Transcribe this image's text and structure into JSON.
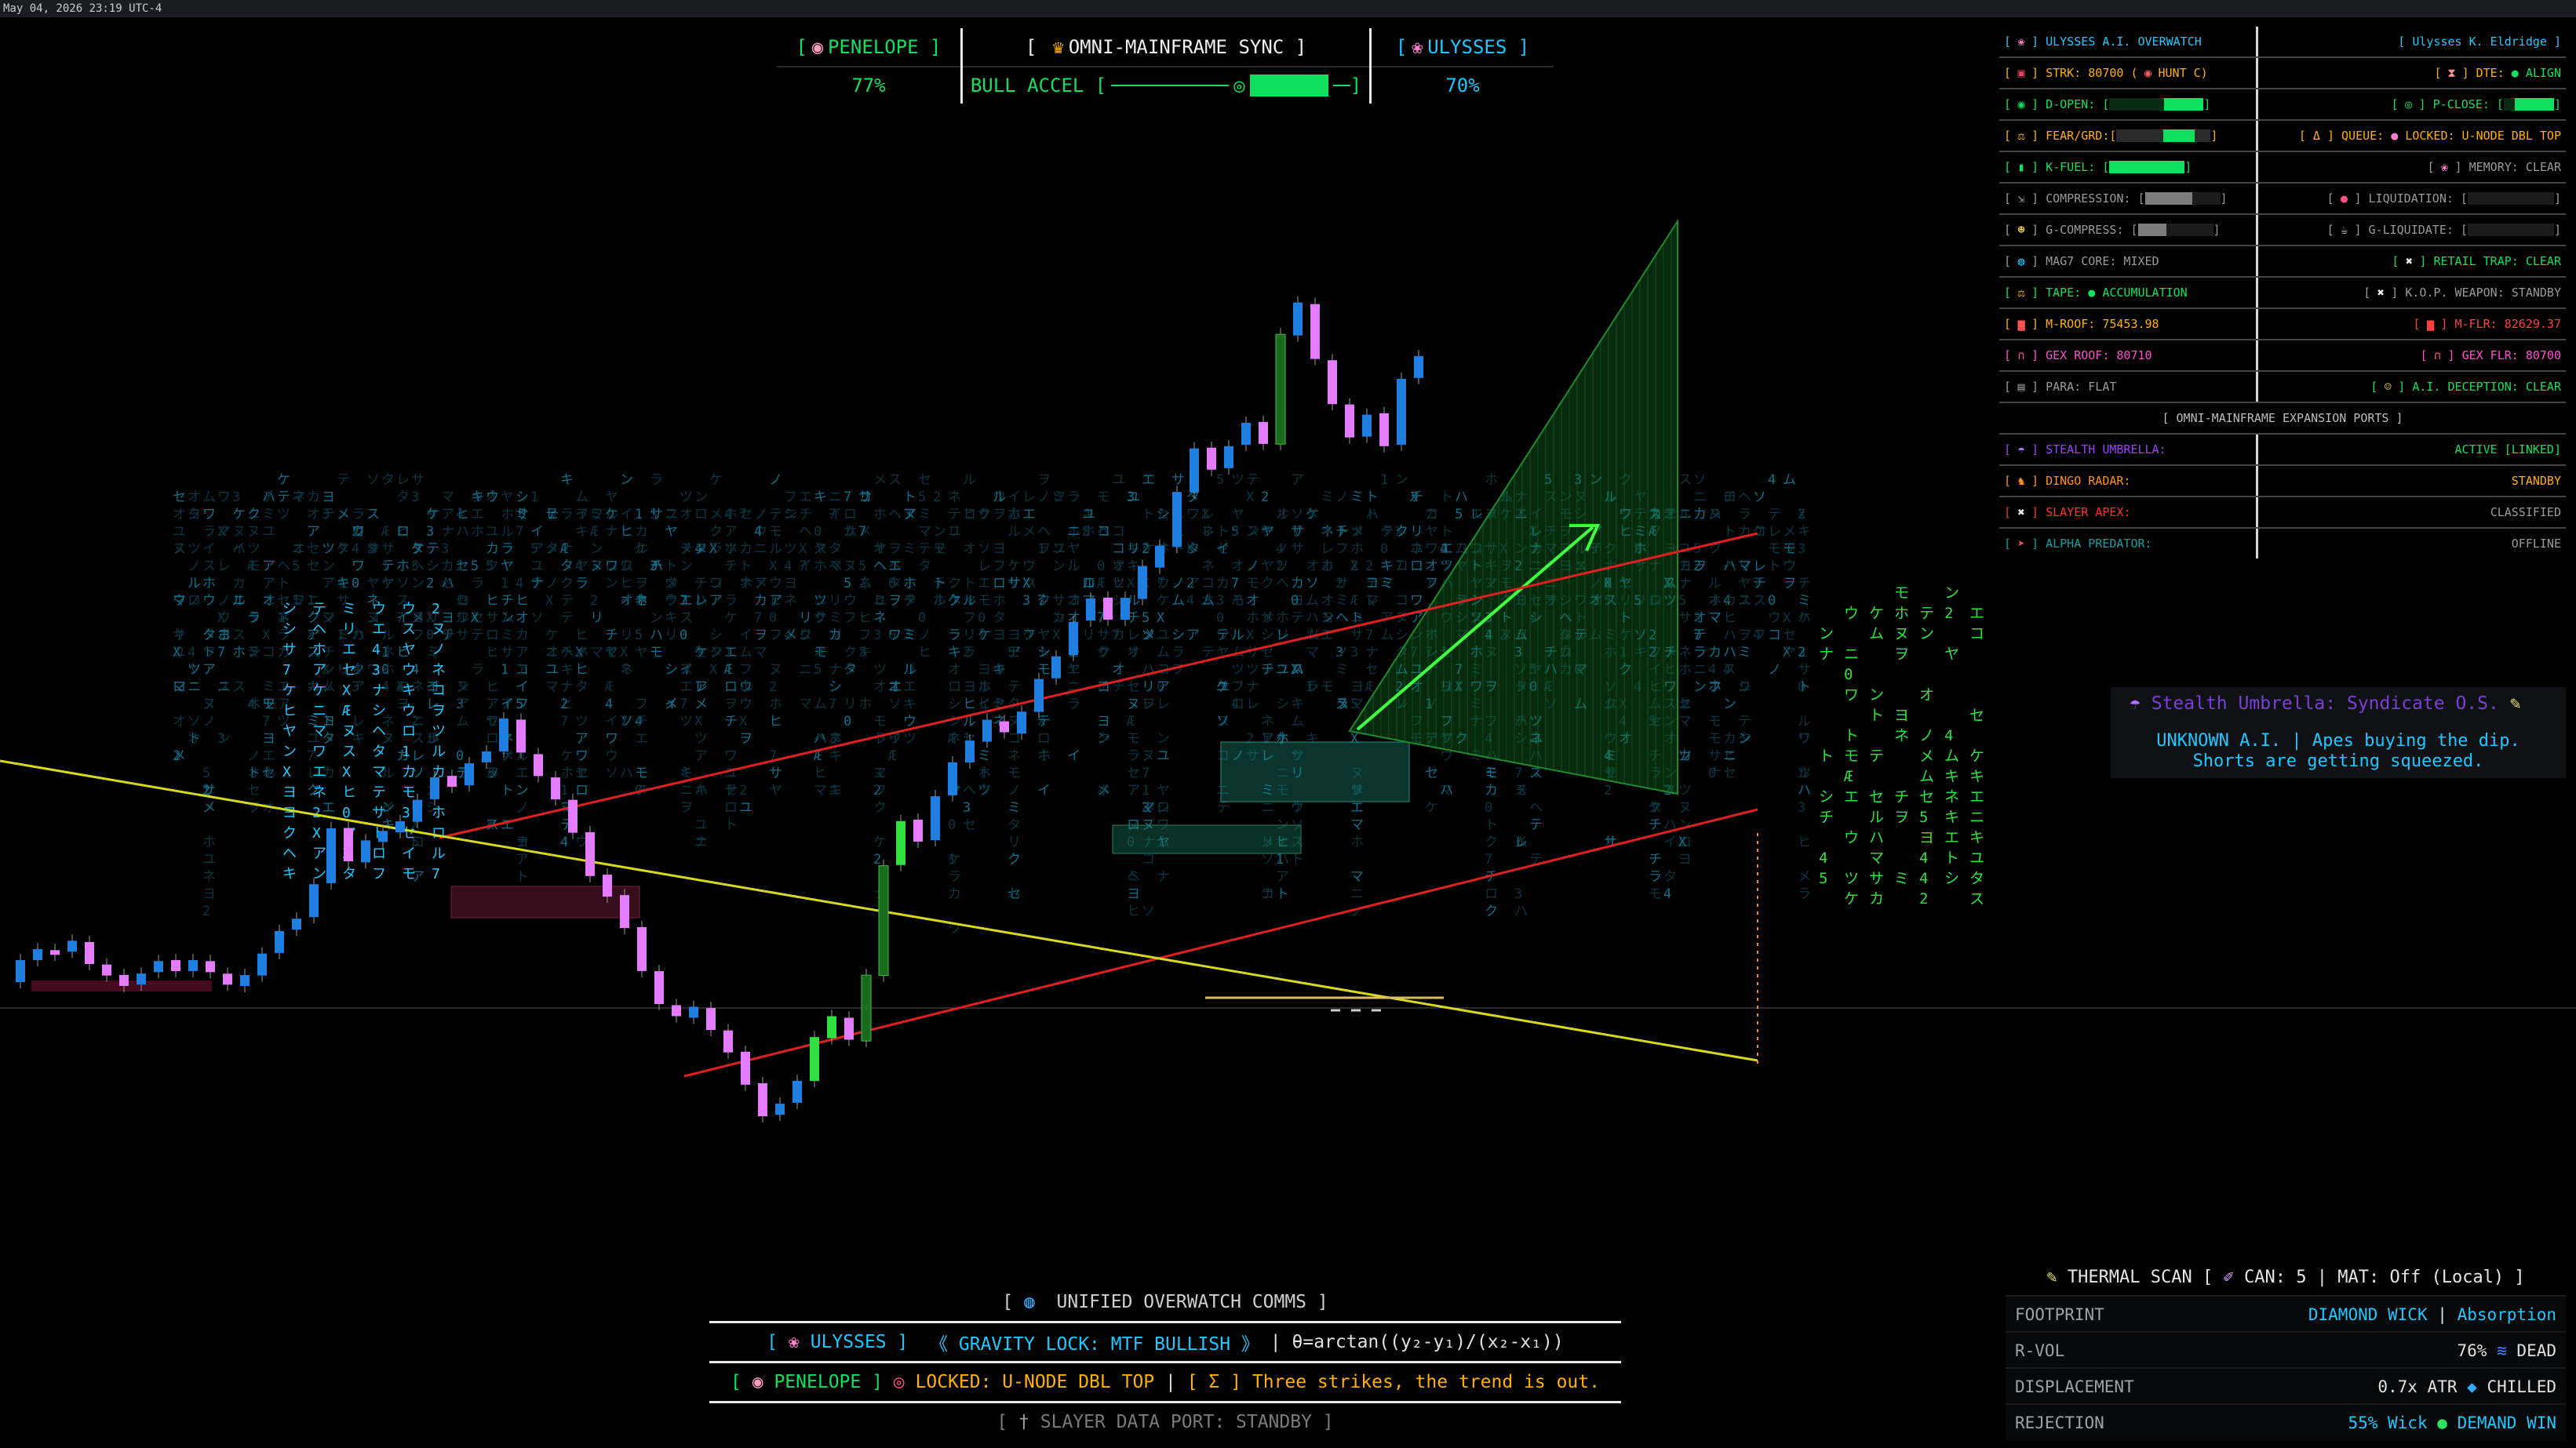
{
  "topbar": {
    "datetime": "May 04, 2026 23:19 UTC-4"
  },
  "sync_panel": {
    "left_name": "PENELOPE",
    "left_value": "77%",
    "center_title": "OMNI-MAINFRAME SYNC",
    "center_label": "BULL ACCEL",
    "right_name": "ULYSSES",
    "right_value": "70%"
  },
  "overwatch": {
    "header_left": "ULYSSES A.I. OVERWATCH",
    "header_right": "Ulysses K. Eldridge",
    "rows": [
      {
        "l": "STRK: 80700 (",
        "l2": "HUNT C)",
        "r": "DTE:",
        "r2": "ALIGN"
      },
      {
        "l": "D-OPEN:",
        "r": "P-CLOSE:"
      },
      {
        "l": "FEAR/GRD:",
        "r": "QUEUE:",
        "r2": "LOCKED: U-NODE DBL TOP"
      },
      {
        "l": "K-FUEL:",
        "r": "MEMORY: CLEAR"
      },
      {
        "l": "COMPRESSION:",
        "r": "LIQUIDATION:"
      },
      {
        "l": "G-COMPRESS:",
        "r": "G-LIQUIDATE:"
      },
      {
        "l": "MAG7 CORE: MIXED",
        "r": "RETAIL TRAP: CLEAR"
      },
      {
        "l": "TAPE:",
        "l2": "ACCUMULATION",
        "r": "K.O.P. WEAPON: STANDBY"
      },
      {
        "l": "M-ROOF: 75453.98",
        "r": "M-FLR: 82629.37"
      },
      {
        "l": "GEX ROOF: 80710",
        "r": "GEX FLR: 80700"
      },
      {
        "l": "PARA: FLAT",
        "r": "A.I. DECEPTION: CLEAR"
      }
    ],
    "ports_title": "[ OMNI-MAINFRAME EXPANSION PORTS ]",
    "ports": [
      {
        "l": "STEALTH UMBRELLA:",
        "r": "ACTIVE [LINKED]"
      },
      {
        "l": "DINGO RADAR:",
        "r": "STANDBY"
      },
      {
        "l": "SLAYER APEX:",
        "r": "CLASSIFIED"
      },
      {
        "l": "ALPHA PREDATOR:",
        "r": "OFFLINE"
      }
    ]
  },
  "stealth": {
    "title": "Stealth Umbrella: Syndicate O.S.",
    "line1": "UNKNOWN A.I. | Apes buying the dip.",
    "line2": "Shorts are getting squeezed."
  },
  "thermal": {
    "title": "THERMAL SCAN [",
    "can": "CAN: 5",
    "mat": "MAT: Off (Local) ]",
    "rows": [
      {
        "k": "FOOTPRINT",
        "v1": "DIAMOND WICK",
        "v2": "Absorption"
      },
      {
        "k": "R-VOL",
        "v1": "76%",
        "v2": "DEAD"
      },
      {
        "k": "DISPLACEMENT",
        "v1": "0.7x ATR",
        "v2": "CHILLED"
      },
      {
        "k": "REJECTION",
        "v1": "55% Wick",
        "v2": "DEMAND WIN"
      }
    ]
  },
  "comms": {
    "title": "UNIFIED OVERWATCH COMMS",
    "u_name": "ULYSSES",
    "u_msg": "《 GRAVITY LOCK: MTF BULLISH 》",
    "u_formula": "θ=arctan((y₂-y₁)/(x₂-x₁))",
    "p_name": "PENELOPE",
    "p_msg": "LOCKED: U-NODE DBL TOP",
    "p_sigma": "Σ",
    "p_msg2": "Three strikes, the trend is out.",
    "slayer": "SLAYER DATA PORT: STANDBY"
  },
  "colors": {
    "cyan": "#1ec8ff",
    "green": "#10e060",
    "pink": "#e47cff",
    "blue": "#1e7fe0",
    "red": "#e02020",
    "yellow": "#d8d820",
    "purple": "#7a3fd6"
  },
  "chart_data": {
    "type": "candlestick",
    "candles": [
      [
        1,
        2
      ],
      [
        1,
        1
      ],
      [
        0,
        2
      ],
      [
        1,
        1
      ],
      [
        -1,
        2
      ],
      [
        -1,
        1
      ],
      [
        -1,
        1
      ],
      [
        1,
        1
      ],
      [
        1,
        1
      ],
      [
        -1,
        1
      ],
      [
        1,
        1
      ],
      [
        -1,
        1
      ],
      [
        -1,
        1
      ],
      [
        1,
        1
      ],
      [
        1,
        2
      ],
      [
        1,
        2
      ],
      [
        1,
        1
      ],
      [
        1,
        3
      ],
      [
        1,
        5
      ],
      [
        -1,
        3
      ],
      [
        1,
        2
      ],
      [
        1,
        1
      ],
      [
        1,
        1
      ],
      [
        1,
        2
      ],
      [
        1,
        2
      ],
      [
        -1,
        1
      ],
      [
        1,
        2
      ],
      [
        1,
        1
      ],
      [
        1,
        3
      ],
      [
        -1,
        3
      ],
      [
        -1,
        2
      ],
      [
        -1,
        2
      ],
      [
        -1,
        3
      ],
      [
        -1,
        4
      ],
      [
        -1,
        2
      ],
      [
        -1,
        3
      ],
      [
        -1,
        4
      ],
      [
        -1,
        3
      ],
      [
        -1,
        1
      ],
      [
        1,
        1
      ],
      [
        -1,
        2
      ],
      [
        -1,
        2
      ],
      [
        -1,
        3
      ],
      [
        -1,
        3
      ],
      [
        1,
        1
      ],
      [
        1,
        2
      ],
      [
        1,
        4
      ],
      [
        1,
        2
      ],
      [
        -1,
        2
      ],
      [
        1,
        6
      ],
      [
        1,
        10
      ],
      [
        1,
        4
      ],
      [
        -1,
        2
      ],
      [
        1,
        4
      ],
      [
        1,
        3
      ],
      [
        1,
        2
      ],
      [
        1,
        2
      ],
      [
        -1,
        1
      ],
      [
        1,
        2
      ],
      [
        1,
        3
      ],
      [
        1,
        2
      ],
      [
        1,
        3
      ],
      [
        1,
        2
      ],
      [
        -1,
        2
      ],
      [
        1,
        2
      ],
      [
        1,
        3
      ],
      [
        1,
        2
      ],
      [
        1,
        5
      ],
      [
        1,
        4
      ],
      [
        -1,
        2
      ],
      [
        1,
        2
      ],
      [
        1,
        2
      ],
      [
        -1,
        2
      ],
      [
        1,
        10
      ],
      [
        1,
        3
      ],
      [
        -1,
        5
      ],
      [
        -1,
        4
      ],
      [
        -1,
        3
      ],
      [
        1,
        2
      ],
      [
        -1,
        3
      ],
      [
        1,
        6
      ],
      [
        1,
        2
      ]
    ]
  }
}
